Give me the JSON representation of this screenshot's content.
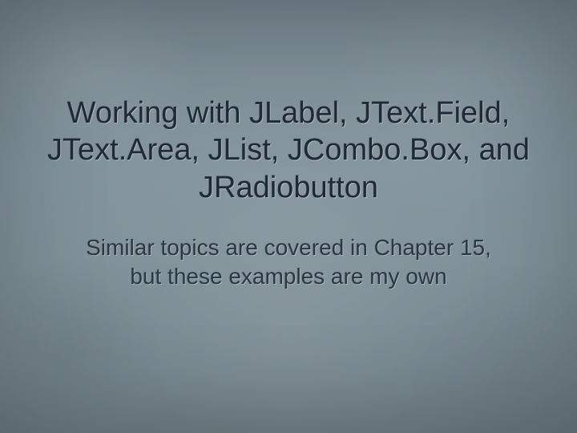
{
  "title": "Working with JLabel, JText.Field, JText.Area,  JList, JCombo.Box, and JRadiobutton",
  "subtitle": "Similar topics are covered in Chapter 15, but these examples are my own"
}
